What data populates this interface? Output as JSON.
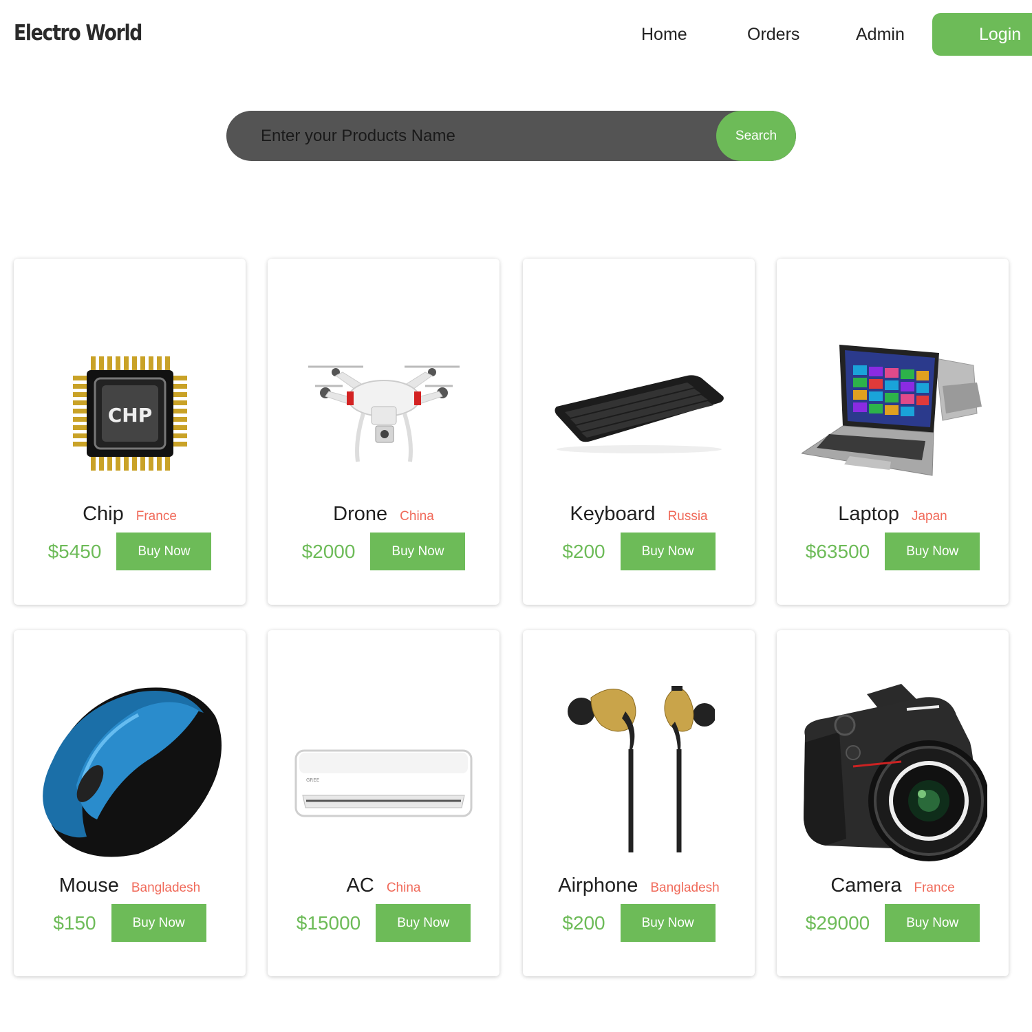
{
  "header": {
    "logo": "Electro World",
    "nav": {
      "home": "Home",
      "orders": "Orders",
      "admin": "Admin"
    },
    "login_label": "Login"
  },
  "search": {
    "placeholder": "Enter your Products Name",
    "button_label": "Search"
  },
  "colors": {
    "accent": "#6dbb58",
    "origin": "#f06a5a",
    "search_bg": "#545454"
  },
  "products": [
    {
      "name": "Chip",
      "origin": "France",
      "price": "$5450",
      "button": "Buy Now",
      "icon": "chip-image"
    },
    {
      "name": "Drone",
      "origin": "China",
      "price": "$2000",
      "button": "Buy Now",
      "icon": "drone-image"
    },
    {
      "name": "Keyboard",
      "origin": "Russia",
      "price": "$200",
      "button": "Buy Now",
      "icon": "keyboard-image"
    },
    {
      "name": "Laptop",
      "origin": "Japan",
      "price": "$63500",
      "button": "Buy Now",
      "icon": "laptop-image"
    },
    {
      "name": "Mouse",
      "origin": "Bangladesh",
      "price": "$150",
      "button": "Buy Now",
      "icon": "mouse-image"
    },
    {
      "name": "AC",
      "origin": "China",
      "price": "$15000",
      "button": "Buy Now",
      "icon": "ac-image"
    },
    {
      "name": "Airphone",
      "origin": "Bangladesh",
      "price": "$200",
      "button": "Buy Now",
      "icon": "earphone-image"
    },
    {
      "name": "Camera",
      "origin": "France",
      "price": "$29000",
      "button": "Buy Now",
      "icon": "camera-image"
    }
  ]
}
